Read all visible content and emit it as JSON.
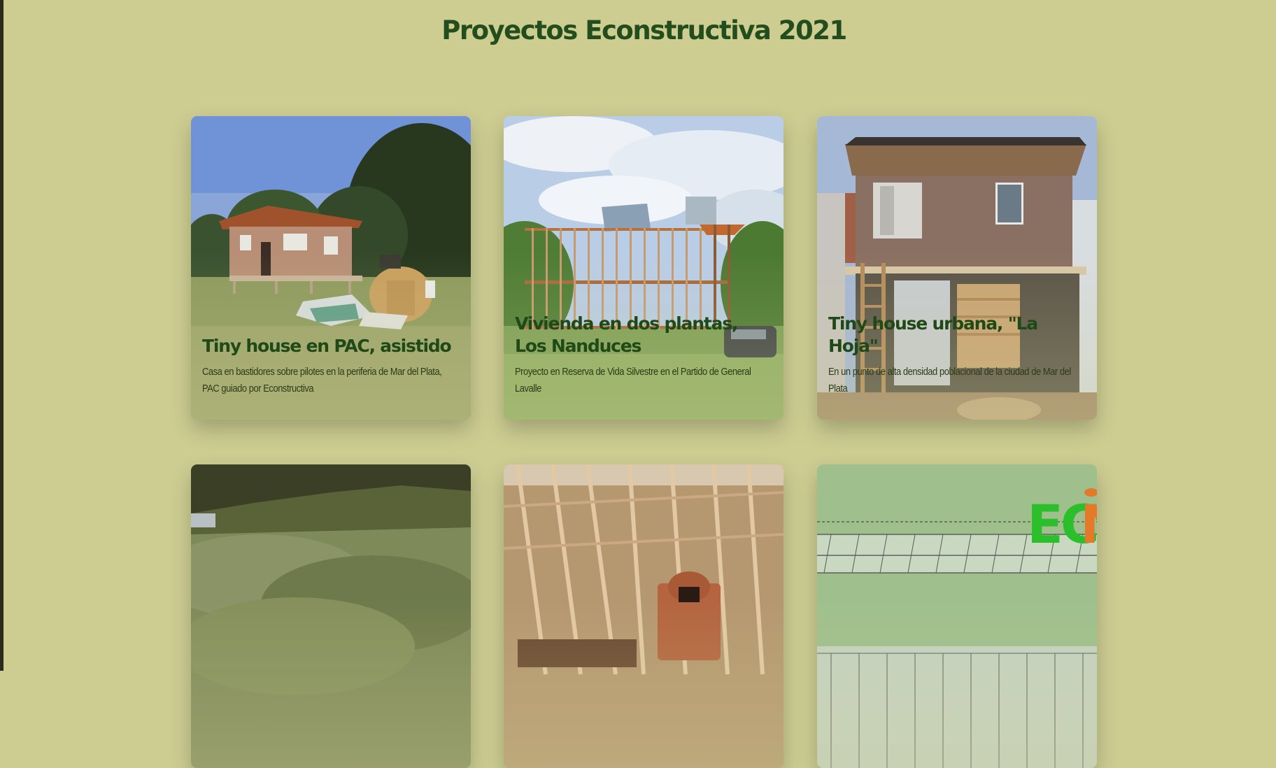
{
  "page": {
    "title": "Proyectos Econstructiva 2021"
  },
  "cards": [
    {
      "title": "Tiny house en PAC, asistido",
      "description": "Casa en bastidores sobre pilotes en la periferia de Mar del Plata, PAC guiado por Econstructiva"
    },
    {
      "title": "Vivienda en dos plantas, Los Nanduces",
      "description": "Proyecto en Reserva de Vida Silvestre en el Partido de General Lavalle"
    },
    {
      "title": "Tiny house urbana, \"La Hoja\"",
      "description": "En un punto de alta densidad poblacional de la ciudad de Mar del Plata"
    },
    {
      "title": "",
      "description": ""
    },
    {
      "title": "",
      "description": ""
    },
    {
      "title": "",
      "description": "",
      "logo_text": "ECONS"
    }
  ],
  "colors": {
    "background": "#cdcd92",
    "title": "#234d1c",
    "card_title": "#1f4a17"
  }
}
